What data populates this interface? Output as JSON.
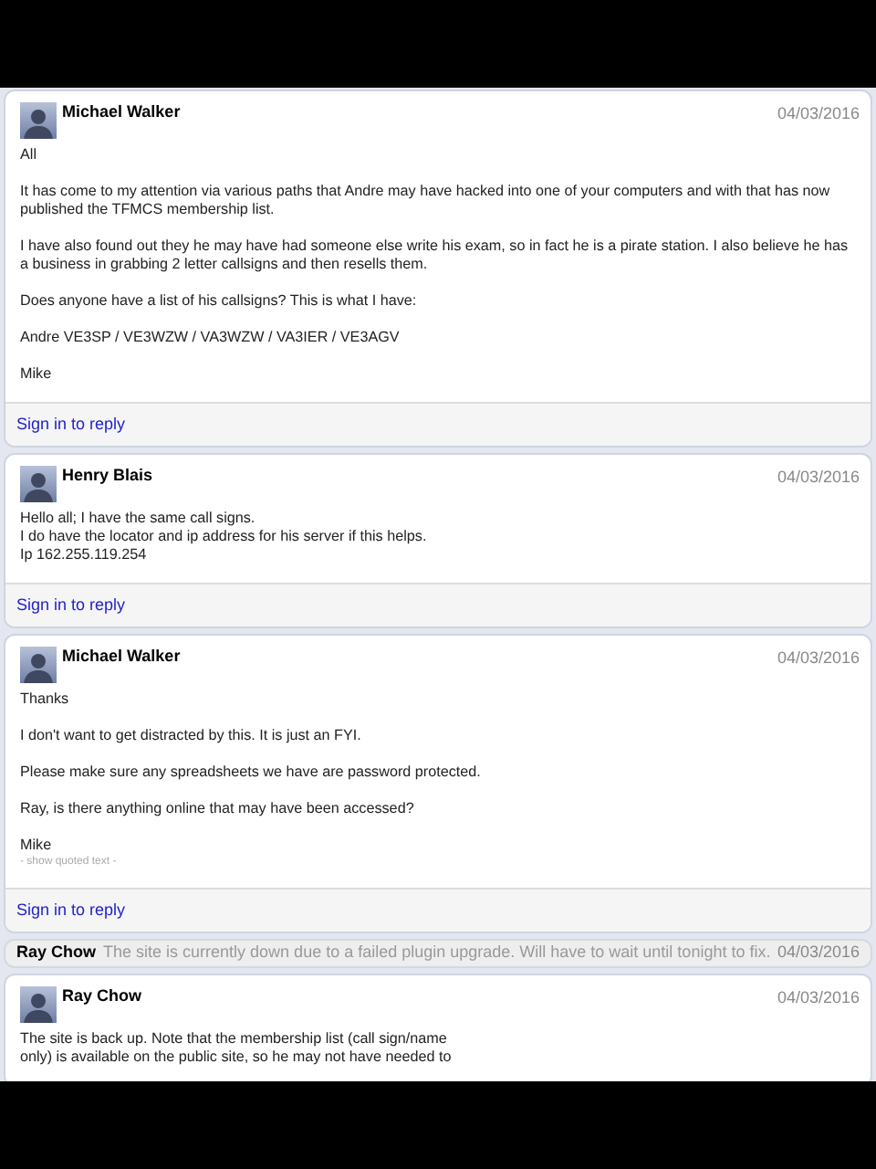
{
  "posts": [
    {
      "kind": "expanded",
      "author": "Michael Walker",
      "date": "04/03/2016",
      "paragraphs": [
        [
          "All"
        ],
        [
          "It has come to my attention via various paths that Andre may have hacked into one of your computers and with that has now",
          "published the TFMCS membership list."
        ],
        [
          "I have also found out they he may have had someone else write his exam, so in fact he is a pirate station.  I also believe he has",
          "a business in grabbing 2 letter callsigns and then resells them."
        ],
        [
          "Does anyone have a list of his callsigns?  This is what I have:"
        ],
        [
          "Andre VE3SP / VE3WZW / VA3WZW / VA3IER / VE3AGV"
        ],
        [
          "Mike"
        ]
      ],
      "reply": "Sign in to reply"
    },
    {
      "kind": "expanded",
      "author": "Henry Blais",
      "date": "04/03/2016",
      "paragraphs": [
        [
          "Hello all; I have the same call signs.",
          "I do have the locator and ip address for his server if this helps.",
          "Ip 162.255.119.254"
        ]
      ],
      "reply": "Sign in to reply"
    },
    {
      "kind": "expanded",
      "author": "Michael Walker",
      "date": "04/03/2016",
      "paragraphs": [
        [
          "Thanks"
        ],
        [
          "I don't want to get distracted by this.  It is just an FYI."
        ],
        [
          "Please make sure any spreadsheets we have are password protected."
        ],
        [
          "Ray, is there anything online that may have been accessed?"
        ],
        [
          "Mike"
        ]
      ],
      "quoted_toggle": "- show quoted text -",
      "reply": "Sign in to reply"
    },
    {
      "kind": "collapsed",
      "author": "Ray Chow",
      "snippet": "The site is currently down due to a failed plugin upgrade. Will have to wait until tonight to fix.",
      "date": "04/03/2016"
    },
    {
      "kind": "expanded",
      "author": "Ray Chow",
      "date": "04/03/2016",
      "paragraphs": [
        [
          "The site is back up. Note that the membership list (call sign/name",
          "only) is available on the public site, so he may not have needed to"
        ]
      ]
    }
  ]
}
